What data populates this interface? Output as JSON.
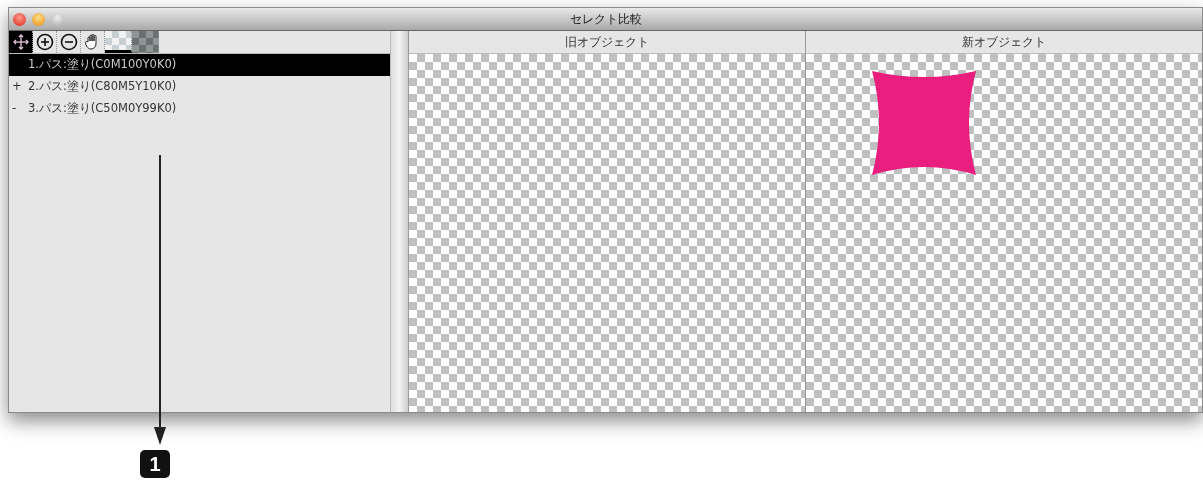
{
  "window": {
    "title": "セレクト比較"
  },
  "toolbar": [
    {
      "kind": "move",
      "selected": true
    },
    {
      "kind": "zoom-in",
      "selected": false
    },
    {
      "kind": "zoom-out",
      "selected": false
    },
    {
      "kind": "hand",
      "selected": false
    },
    {
      "kind": "light-background",
      "selected": true
    },
    {
      "kind": "dark-background",
      "selected": false
    }
  ],
  "objects": [
    {
      "label": "1.パス:塗り(C0M100Y0K0)",
      "selected": true
    },
    {
      "marker": "+",
      "label": "2.パス:塗り(C80M5Y10K0)",
      "selected": false
    },
    {
      "marker": "-",
      "label": "3.パス:塗り(C50M0Y99K0)",
      "selected": false
    }
  ],
  "panes": [
    {
      "title": "旧オブジェクト"
    },
    {
      "title": "新オブジェクト",
      "color": "#e91e7e"
    }
  ],
  "callout": {
    "number": "1"
  }
}
